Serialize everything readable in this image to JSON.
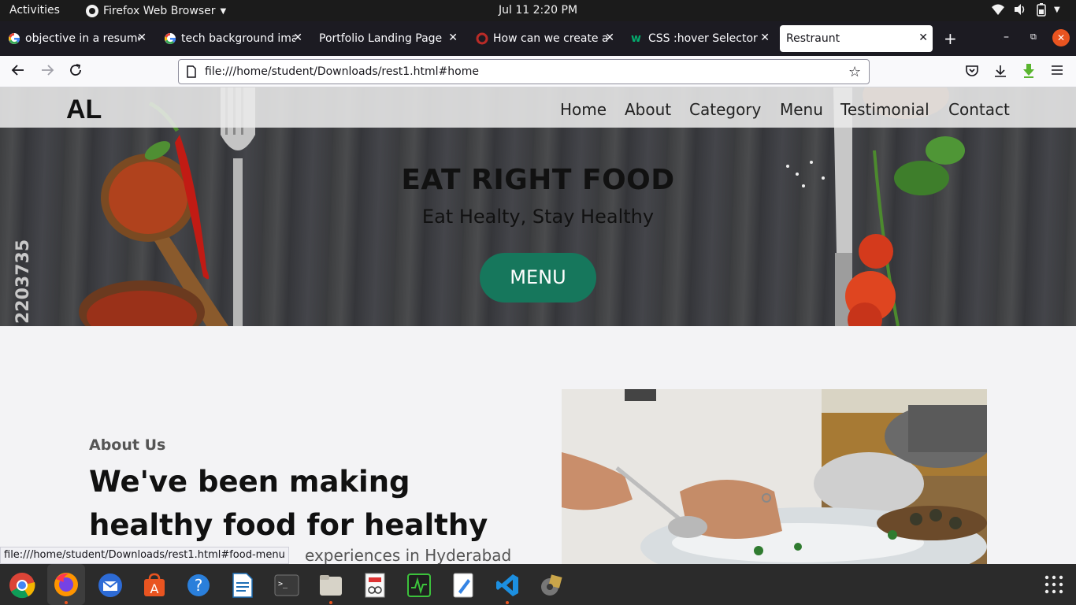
{
  "system": {
    "activities": "Activities",
    "app_menu": "Firefox Web Browser",
    "clock": "Jul 11   2:20 PM"
  },
  "tabs": [
    {
      "title": "objective in a resume",
      "icon": "google-icon"
    },
    {
      "title": "tech background ima",
      "icon": "google-icon"
    },
    {
      "title": "Portfolio Landing Page",
      "icon": "none"
    },
    {
      "title": "How can we create a",
      "icon": "quora-icon"
    },
    {
      "title": "CSS :hover Selector",
      "icon": "w3schools-icon"
    },
    {
      "title": "Restraunt",
      "icon": "none",
      "active": true
    }
  ],
  "urlbar": {
    "url": "file:///home/student/Downloads/rest1.html#home"
  },
  "site": {
    "logo": "AL",
    "nav": [
      "Home",
      "About",
      "Category",
      "Menu",
      "Testimonial",
      "Contact"
    ],
    "hero_title": "EAT RIGHT FOOD",
    "hero_subtitle": "Eat Healty, Stay Healthy",
    "hero_button": "MENU",
    "watermark_number": "2203735",
    "about_label": "About Us",
    "about_heading": "We've been making healthy food for healthy life",
    "about_text_visible": "experiences in Hyderabad"
  },
  "status_link": "file:///home/student/Downloads/rest1.html#food-menu",
  "colors": {
    "accent": "#16775c",
    "topbar": "#1b1b1b",
    "tabstrip": "#1c1b22",
    "dock_indicator": "#e95420"
  },
  "dock": [
    "chrome-icon",
    "firefox-icon",
    "thunderbird-icon",
    "software-center-icon",
    "help-icon",
    "libreoffice-writer-icon",
    "terminal-icon",
    "files-icon",
    "document-viewer-icon",
    "system-monitor-icon",
    "text-editor-icon",
    "vscode-icon",
    "package-installer-icon"
  ]
}
